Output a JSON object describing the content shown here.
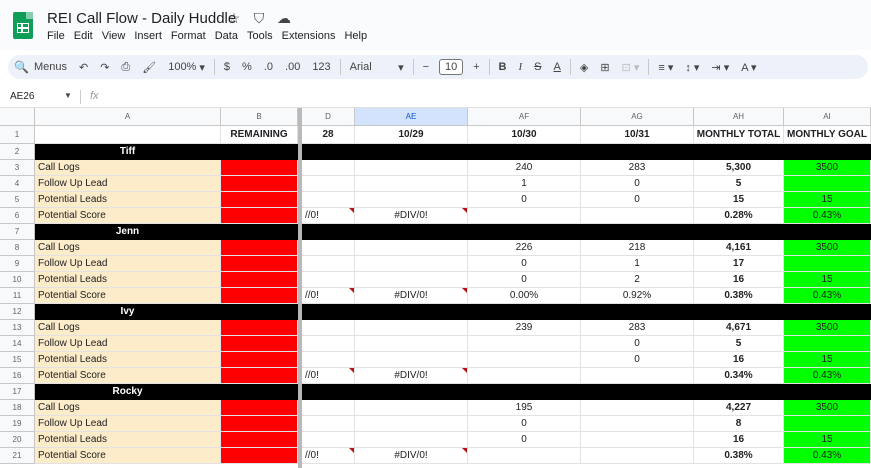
{
  "app": {
    "title": "REI Call Flow - Daily Huddle",
    "title_icons": [
      "star-icon",
      "move-to-drive-icon",
      "cloud-status-icon"
    ],
    "menus": [
      "File",
      "Edit",
      "View",
      "Insert",
      "Format",
      "Data",
      "Tools",
      "Extensions",
      "Help"
    ]
  },
  "toolbar": {
    "search_label": "Menus",
    "zoom": "100%",
    "currency": "$",
    "percent": "%",
    "dec_decrease": ".0",
    "dec_increase": ".00",
    "number_format": "123",
    "font": "Arial",
    "font_size": "10",
    "bold": "B",
    "italic": "I",
    "strike": "S",
    "text_color": "A"
  },
  "formula_bar": {
    "name_box": "AE26",
    "fx": "fx"
  },
  "columns": [
    {
      "id": "A",
      "label": "A"
    },
    {
      "id": "B",
      "label": "B"
    },
    {
      "id": "AD",
      "label": "D"
    },
    {
      "id": "AE",
      "label": "AE"
    },
    {
      "id": "AF",
      "label": "AF"
    },
    {
      "id": "AG",
      "label": "AG"
    },
    {
      "id": "AH",
      "label": "AH"
    },
    {
      "id": "AI",
      "label": "AI"
    }
  ],
  "header_row": {
    "row_num": "1",
    "cells": [
      "",
      "REMAINING",
      "28",
      "10/29",
      "10/30",
      "10/31",
      "MONTHLY TOTAL",
      "MONTHLY GOAL"
    ]
  },
  "sections": [
    {
      "name": "Tiff",
      "header_row": "2",
      "rows": [
        {
          "num": "3",
          "label": "Call Logs",
          "ad": "",
          "ae": "",
          "af": "240",
          "ag": "283",
          "ah": "5,300",
          "ai": "3500"
        },
        {
          "num": "4",
          "label": "Follow Up Lead",
          "ad": "",
          "ae": "",
          "af": "1",
          "ag": "0",
          "ah": "5",
          "ai": ""
        },
        {
          "num": "5",
          "label": "Potential Leads",
          "ad": "",
          "ae": "",
          "af": "0",
          "ag": "0",
          "ah": "15",
          "ai": "15"
        },
        {
          "num": "6",
          "label": "Potential Score",
          "ad": "//0!",
          "ae": "#DIV/0!",
          "af": "",
          "ag": "",
          "ah": "0.28%",
          "ai": "0.43%"
        }
      ]
    },
    {
      "name": "Jenn",
      "header_row": "7",
      "rows": [
        {
          "num": "8",
          "label": "Call Logs",
          "ad": "",
          "ae": "",
          "af": "226",
          "ag": "218",
          "ah": "4,161",
          "ai": "3500"
        },
        {
          "num": "9",
          "label": "Follow Up Lead",
          "ad": "",
          "ae": "",
          "af": "0",
          "ag": "1",
          "ah": "17",
          "ai": ""
        },
        {
          "num": "10",
          "label": "Potential Leads",
          "ad": "",
          "ae": "",
          "af": "0",
          "ag": "2",
          "ah": "16",
          "ai": "15"
        },
        {
          "num": "11",
          "label": "Potential Score",
          "ad": "//0!",
          "ae": "#DIV/0!",
          "af": "0.00%",
          "ag": "0.92%",
          "ah": "0.38%",
          "ai": "0.43%"
        }
      ]
    },
    {
      "name": "Ivy",
      "header_row": "12",
      "rows": [
        {
          "num": "13",
          "label": "Call Logs",
          "ad": "",
          "ae": "",
          "af": "239",
          "ag": "283",
          "ah": "4,671",
          "ai": "3500"
        },
        {
          "num": "14",
          "label": "Follow Up Lead",
          "ad": "",
          "ae": "",
          "af": "",
          "ag": "0",
          "ah": "5",
          "ai": ""
        },
        {
          "num": "15",
          "label": "Potential Leads",
          "ad": "",
          "ae": "",
          "af": "",
          "ag": "0",
          "ah": "16",
          "ai": "15"
        },
        {
          "num": "16",
          "label": "Potential Score",
          "ad": "//0!",
          "ae": "#DIV/0!",
          "af": "",
          "ag": "",
          "ah": "0.34%",
          "ai": "0.43%"
        }
      ]
    },
    {
      "name": "Rocky",
      "header_row": "17",
      "rows": [
        {
          "num": "18",
          "label": "Call Logs",
          "ad": "",
          "ae": "",
          "af": "195",
          "ag": "",
          "ah": "4,227",
          "ai": "3500"
        },
        {
          "num": "19",
          "label": "Follow Up Lead",
          "ad": "",
          "ae": "",
          "af": "0",
          "ag": "",
          "ah": "8",
          "ai": ""
        },
        {
          "num": "20",
          "label": "Potential Leads",
          "ad": "",
          "ae": "",
          "af": "0",
          "ag": "",
          "ah": "16",
          "ai": "15"
        },
        {
          "num": "21",
          "label": "Potential Score",
          "ad": "//0!",
          "ae": "#DIV/0!",
          "af": "",
          "ag": "",
          "ah": "0.38%",
          "ai": "0.43%"
        }
      ]
    }
  ],
  "colors": {
    "label_bg": "#fdecc9",
    "remaining_bg": "#ff0000",
    "goal_bg": "#00ff00",
    "section_bg": "#000000",
    "selected_col": "#d3e3fd"
  }
}
